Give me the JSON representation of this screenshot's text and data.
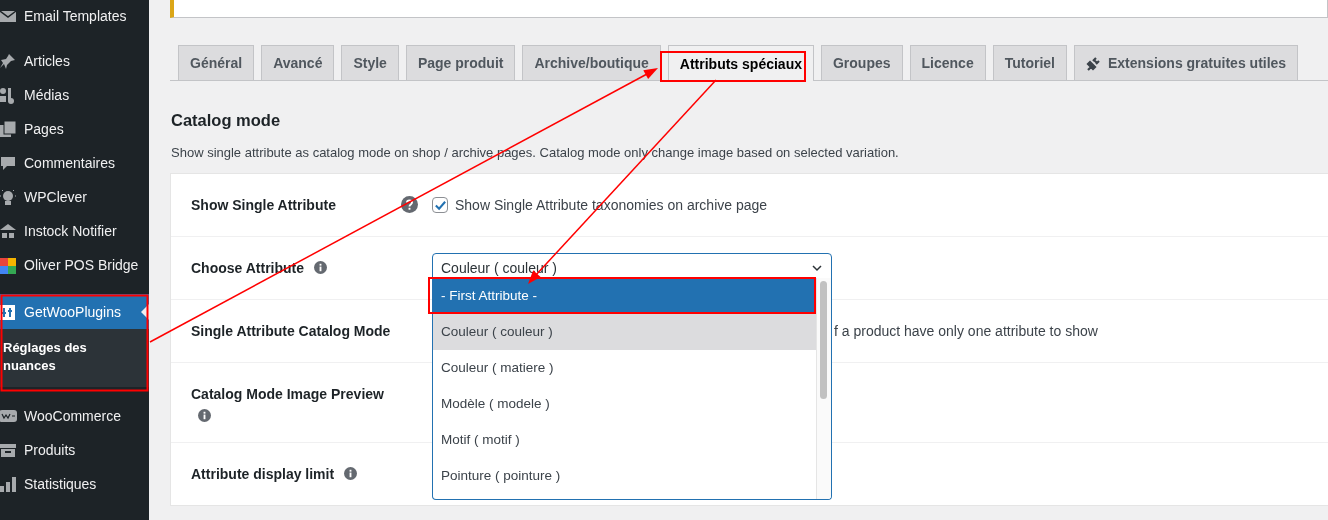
{
  "sidebar": {
    "sections": [
      {
        "items": [
          {
            "label": "Email Templates",
            "selected": false
          }
        ]
      },
      {
        "items": [
          {
            "label": "Articles",
            "selected": false
          },
          {
            "label": "Médias",
            "selected": false
          },
          {
            "label": "Pages",
            "selected": false
          },
          {
            "label": "Commentaires",
            "selected": false
          },
          {
            "label": "WPClever",
            "selected": false
          },
          {
            "label": "Instock Notifier",
            "selected": false
          },
          {
            "label": "Oliver POS Bridge",
            "selected": false
          }
        ]
      },
      {
        "items": [
          {
            "label": "GetWooPlugins",
            "selected": true,
            "children": [
              {
                "label": "Réglages des nuances",
                "selected": true
              }
            ]
          }
        ]
      },
      {
        "items": [
          {
            "label": "WooCommerce",
            "selected": false
          },
          {
            "label": "Produits",
            "selected": false
          },
          {
            "label": "Statistiques",
            "selected": false
          }
        ]
      }
    ]
  },
  "tabs": [
    {
      "label": "Général",
      "selected": false,
      "kind": "plain"
    },
    {
      "label": "Avancé",
      "selected": false,
      "kind": "plain"
    },
    {
      "label": "Style",
      "selected": false,
      "kind": "plain"
    },
    {
      "label": "Page produit",
      "selected": false,
      "kind": "plain"
    },
    {
      "label": "Archive/boutique",
      "selected": false,
      "kind": "plain"
    },
    {
      "label": "Attributs spéciaux",
      "selected": true,
      "kind": "plain"
    },
    {
      "label": "Groupes",
      "selected": false,
      "kind": "plain"
    },
    {
      "label": "Licence",
      "selected": false,
      "kind": "plain"
    },
    {
      "label": "Tutoriel",
      "selected": false,
      "kind": "plain"
    },
    {
      "label": "Extensions gratuites utiles",
      "selected": false,
      "kind": "plugin"
    }
  ],
  "section": {
    "title": "Catalog mode",
    "description": "Show single attribute as catalog mode on shop / archive pages. Catalog mode only change image based on selected variation."
  },
  "settings": [
    {
      "kind": "checkbox",
      "label": "Show Single Attribute",
      "help_icon": true,
      "checked": true,
      "text": "Show Single Attribute taxonomies on archive page"
    },
    {
      "kind": "select",
      "label": "Choose Attribute",
      "help_icon": true,
      "value": "Couleur ( couleur )",
      "expanded": true,
      "options": [
        {
          "label": "- First Attribute -",
          "selected": false,
          "highlighted": true
        },
        {
          "label": "Couleur ( couleur )",
          "selected": true,
          "highlighted": false
        },
        {
          "label": "Couleur ( matiere )",
          "selected": false,
          "highlighted": false
        },
        {
          "label": "Modèle ( modele )",
          "selected": false,
          "highlighted": false
        },
        {
          "label": "Motif ( motif )",
          "selected": false,
          "highlighted": false
        },
        {
          "label": "Pointure ( pointure )",
          "selected": false,
          "highlighted": false
        }
      ]
    },
    {
      "kind": "text",
      "label": "Single Attribute Catalog Mode",
      "help_icon": false,
      "text": "f a product have only one attribute to show"
    },
    {
      "kind": "empty",
      "label": "Catalog Mode Image Preview",
      "help_icon": true
    },
    {
      "kind": "empty",
      "label": "Attribute display limit",
      "help_icon": true
    }
  ]
}
